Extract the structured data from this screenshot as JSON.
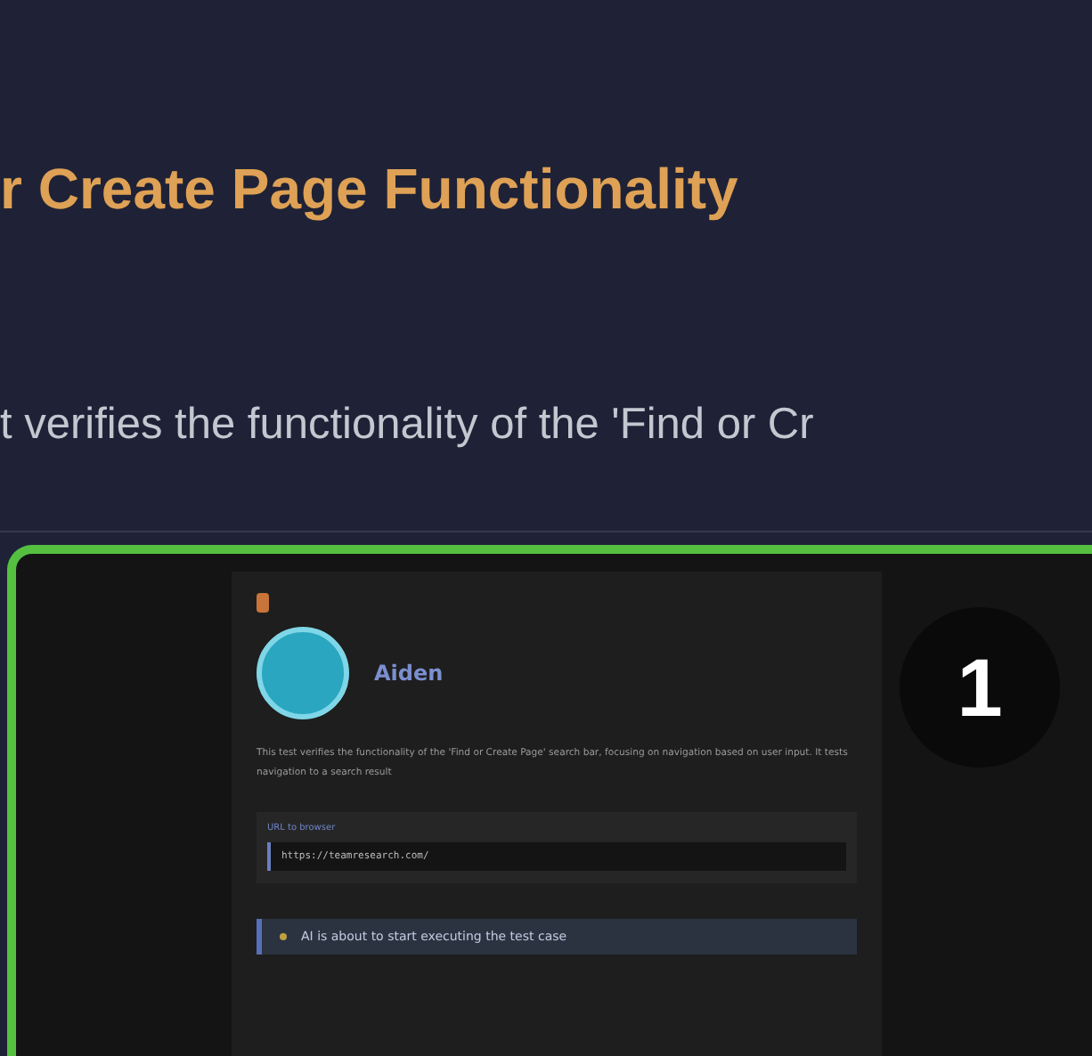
{
  "title": "r Create Page Functionality",
  "subtitle": "t verifies the functionality of the 'Find or Cr",
  "preview": {
    "step_number": "1",
    "agent_name": "Aiden",
    "description": "This test verifies the functionality of the 'Find or Create Page' search bar, focusing on navigation based on user input. It tests navigation to a search result",
    "url_label": "URL to browser",
    "url_value": "https://teamresearch.com/",
    "status_message": "AI is about to start executing the test case"
  }
}
